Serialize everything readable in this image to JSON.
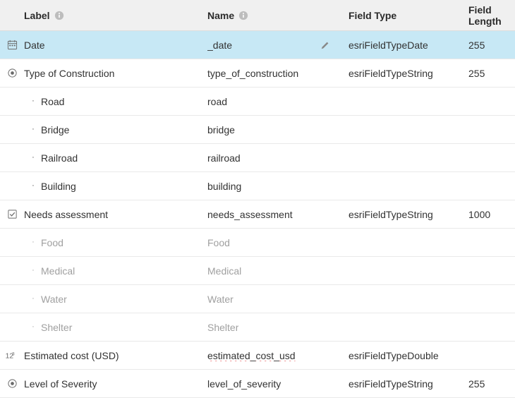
{
  "header": {
    "label": "Label",
    "name": "Name",
    "fieldType": "Field Type",
    "fieldLength": "Field Length"
  },
  "rows": [
    {
      "kind": "field",
      "icon": "calendar",
      "selected": true,
      "editable": true,
      "label": "Date",
      "name": "_date",
      "type": "esriFieldTypeDate",
      "length": "255"
    },
    {
      "kind": "field",
      "icon": "radio",
      "selected": false,
      "editable": false,
      "label": "Type of Construction",
      "name": "type_of_construction",
      "type": "esriFieldTypeString",
      "length": "255"
    },
    {
      "kind": "sub",
      "muted": false,
      "label": "Road",
      "name": "road"
    },
    {
      "kind": "sub",
      "muted": false,
      "label": "Bridge",
      "name": "bridge"
    },
    {
      "kind": "sub",
      "muted": false,
      "label": "Railroad",
      "name": "railroad"
    },
    {
      "kind": "sub",
      "muted": false,
      "label": "Building",
      "name": "building"
    },
    {
      "kind": "field",
      "icon": "checkbox",
      "selected": false,
      "editable": false,
      "label": "Needs assessment",
      "name": "needs_assessment",
      "type": "esriFieldTypeString",
      "length": "1000"
    },
    {
      "kind": "sub",
      "muted": true,
      "label": "Food",
      "name": "Food"
    },
    {
      "kind": "sub",
      "muted": true,
      "label": "Medical",
      "name": "Medical"
    },
    {
      "kind": "sub",
      "muted": true,
      "label": "Water",
      "name": "Water"
    },
    {
      "kind": "sub",
      "muted": true,
      "label": "Shelter",
      "name": "Shelter"
    },
    {
      "kind": "field",
      "icon": "number",
      "selected": false,
      "editable": false,
      "label": "Estimated cost (USD)",
      "name": "estimated_cost_usd",
      "nameSquiggle": true,
      "type": "esriFieldTypeDouble",
      "length": ""
    },
    {
      "kind": "field",
      "icon": "radio",
      "selected": false,
      "editable": false,
      "label": "Level of Severity",
      "name": "level_of_severity",
      "type": "esriFieldTypeString",
      "length": "255"
    }
  ]
}
